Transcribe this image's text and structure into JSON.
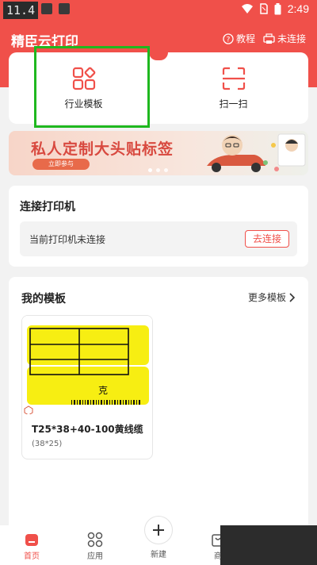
{
  "status_bar": {
    "left_time": "11.4",
    "clock": "2:49"
  },
  "header": {
    "title": "精臣云打印",
    "tutorial_label": "教程",
    "not_connected_label": "未连接"
  },
  "quick_actions": {
    "industry_template_label": "行业模板",
    "scan_label": "扫一扫"
  },
  "banner": {
    "title": "私人定制大头贴标签",
    "button_label": "立即参与",
    "pages": 3,
    "active_page": 1
  },
  "printer": {
    "title": "连接打印机",
    "status_text": "当前打印机未连接",
    "connect_label": "去连接"
  },
  "templates": {
    "title": "我的模板",
    "more_label": "更多模板",
    "items": [
      {
        "name": "T25*38+40-100黄线缆",
        "size": "(38*25)",
        "label_char": "克"
      }
    ]
  },
  "bottom_nav": {
    "items": [
      {
        "label": "首页",
        "icon": "home-icon",
        "active": true
      },
      {
        "label": "应用",
        "icon": "apps-icon",
        "active": false
      },
      {
        "label": "新建",
        "icon": "plus-icon",
        "active": false
      },
      {
        "label": "商",
        "icon": "shop-icon",
        "active": false
      }
    ]
  },
  "colors": {
    "brand_red": "#f0504a",
    "highlight_green": "#1fb81f",
    "label_yellow": "#f7ee12"
  }
}
